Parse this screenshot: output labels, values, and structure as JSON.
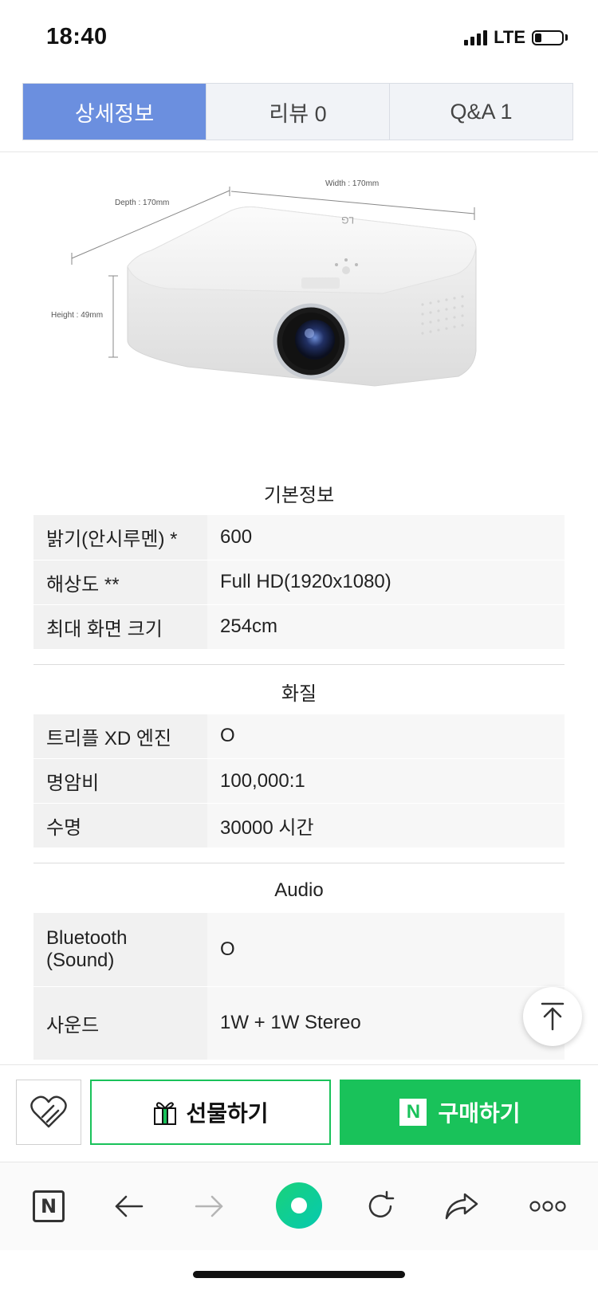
{
  "status": {
    "time": "18:40",
    "network": "LTE"
  },
  "tabs": [
    {
      "label": "상세정보",
      "active": true
    },
    {
      "label": "리뷰  0",
      "active": false
    },
    {
      "label": "Q&A  1",
      "active": false
    }
  ],
  "product_image": {
    "depth": "Depth : 170mm",
    "width": "Width : 170mm",
    "height": "Height : 49mm",
    "logo": "LG"
  },
  "sections": {
    "basic": {
      "title": "기본정보",
      "rows": [
        {
          "key": "밝기(안시루멘) *",
          "value": "600"
        },
        {
          "key": "해상도 **",
          "value": "Full HD(1920x1080)"
        },
        {
          "key": "최대 화면 크기",
          "value": "254cm"
        }
      ]
    },
    "quality": {
      "title": "화질",
      "rows": [
        {
          "key": "트리플 XD 엔진",
          "value": "O"
        },
        {
          "key": "명암비",
          "value": "100,000:1"
        },
        {
          "key": "수명",
          "value": "30000 시간"
        }
      ]
    },
    "audio": {
      "title": "Audio",
      "rows": [
        {
          "key": "Bluetooth (Sound)",
          "value": "O"
        },
        {
          "key": "사운드",
          "value": "1W + 1W Stereo"
        }
      ]
    }
  },
  "purchase": {
    "gift_label": "선물하기",
    "buy_label": "구매하기",
    "buy_badge": "N"
  },
  "browser": {
    "home_badge": "N"
  },
  "colors": {
    "tab_active": "#6b8fdf",
    "naver_green": "#19c25a"
  }
}
